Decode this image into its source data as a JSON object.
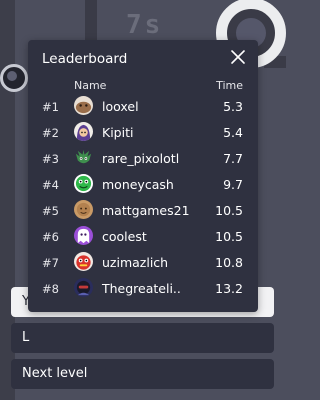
{
  "hud": {
    "timer": "7s"
  },
  "buttons": {
    "first_label": "Y",
    "second_label": "L",
    "next_level_label": "Next level"
  },
  "leaderboard": {
    "title": "Leaderboard",
    "columns": {
      "name": "Name",
      "time": "Time"
    },
    "rows": [
      {
        "rank": "#1",
        "name": "looxel",
        "time": "5.3",
        "avatar": "brown-blob-avatar-icon"
      },
      {
        "rank": "#2",
        "name": "Kipiti",
        "time": "5.4",
        "avatar": "purple-hood-avatar-icon"
      },
      {
        "rank": "#3",
        "name": "rare_pixolotl",
        "time": "7.7",
        "avatar": "green-creature-avatar-icon"
      },
      {
        "rank": "#4",
        "name": "moneycash",
        "time": "9.7",
        "avatar": "green-money-avatar-icon"
      },
      {
        "rank": "#5",
        "name": "mattgames21",
        "time": "10.5",
        "avatar": "tan-face-avatar-icon"
      },
      {
        "rank": "#6",
        "name": "coolest",
        "time": "10.5",
        "avatar": "purple-ghost-avatar-icon"
      },
      {
        "rank": "#7",
        "name": "uzimazlich",
        "time": "10.8",
        "avatar": "red-creature-avatar-icon"
      },
      {
        "rank": "#8",
        "name": "Thegreateli..",
        "time": "13.2",
        "avatar": "dark-knight-avatar-icon"
      }
    ]
  },
  "colors": {
    "modal_bg": "#2f3140",
    "scene_bg": "#4c4e5d",
    "button_dark": "#2f3140",
    "button_light": "#f2f2f4"
  }
}
